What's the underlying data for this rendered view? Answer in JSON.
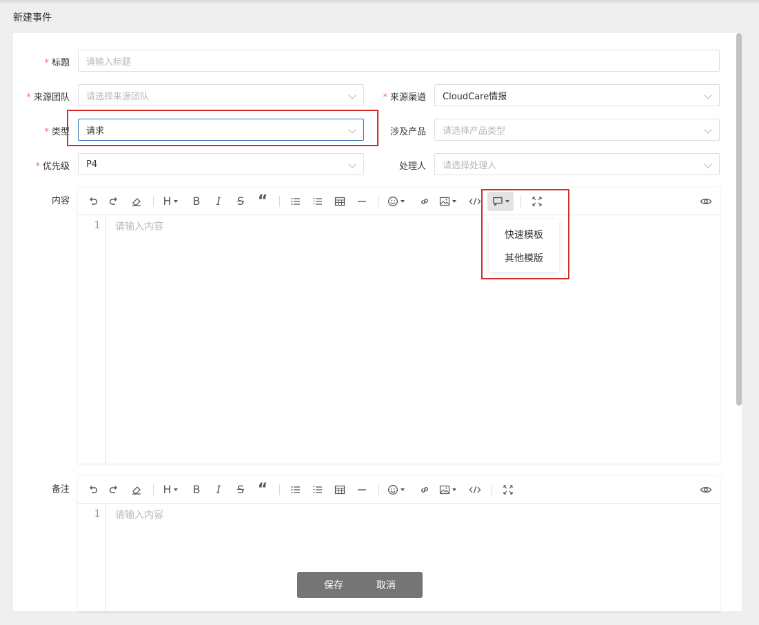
{
  "page": {
    "title": "新建事件"
  },
  "form": {
    "title": {
      "label": "标题",
      "required": true,
      "placeholder": "请输入标题"
    },
    "source_team": {
      "label": "来源团队",
      "required": true,
      "placeholder": "请选择来源团队"
    },
    "source_channel": {
      "label": "来源渠道",
      "required": true,
      "value": "CloudCare情报"
    },
    "type": {
      "label": "类型",
      "required": true,
      "value": "请求"
    },
    "product": {
      "label": "涉及产品",
      "required": false,
      "placeholder": "请选择产品类型"
    },
    "priority": {
      "label": "优先级",
      "required": true,
      "value": "P4"
    },
    "assignee": {
      "label": "处理人",
      "required": false,
      "placeholder": "请选择处理人"
    },
    "required_mark": "*"
  },
  "content_editor": {
    "label": "内容",
    "line_number": "1",
    "placeholder": "请输入内容",
    "template_menu": {
      "items": [
        "快速模板",
        "其他模版"
      ]
    }
  },
  "remark_editor": {
    "label": "备注",
    "line_number": "1",
    "placeholder": "请输入内容"
  },
  "toolbar": {
    "heading_glyph": "H",
    "bold_glyph": "B",
    "italic_glyph": "I",
    "strike_glyph": "S",
    "quote_glyph": "“",
    "icons": [
      "undo-icon",
      "redo-icon",
      "eraser-icon",
      "heading-icon",
      "bold-icon",
      "italic-icon",
      "strikethrough-icon",
      "quote-icon",
      "bullet-list-icon",
      "ordered-list-icon",
      "table-icon",
      "horizontal-rule-icon",
      "emoji-icon",
      "link-icon",
      "image-icon",
      "code-icon",
      "comment-template-icon",
      "fullscreen-icon",
      "preview-eye-icon"
    ]
  },
  "actions": {
    "save_label": "保存",
    "cancel_label": "取消"
  },
  "colors": {
    "required": "#f56c6c",
    "highlight": "#d32a2a",
    "focus_border": "#2c6bb3",
    "action_bar": "#757575"
  }
}
